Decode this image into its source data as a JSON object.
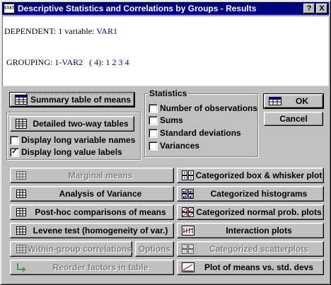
{
  "window": {
    "title": "Descriptive Statistics and Correlations by Groups - Results",
    "help_label": "?",
    "close_label": "X",
    "icon_text": "STAT"
  },
  "results": {
    "dependent_label": "DEPENDENT:",
    "dependent_count": "1 variable:",
    "dependent_var": "VAR1",
    "grouping_label": "GROUPING:",
    "grouping_var": "1-VAR2",
    "grouping_count": "( 4):",
    "grouping_codes": "1 2 3 4"
  },
  "buttons": {
    "summary_table": "Summary table of means",
    "detailed_tables": "Detailed two-way tables",
    "ok": "OK",
    "cancel": "Cancel",
    "marginal_means": "Marginal means",
    "anova": "Analysis of Variance",
    "posthoc": "Post-hoc comparisons of means",
    "levene": "Levene test (homogeneity of var.)",
    "within_group": "Within-group correlations",
    "options": "Options",
    "reorder": "Reorder factors in table",
    "box_whisker": "Categorized box & whisker plot",
    "histograms": "Categorized histograms",
    "normal_prob": "Categorized normal prob. plots",
    "interaction": "Interaction plots",
    "scatterplots": "Categorized scatterplots",
    "means_vs_sd": "Plot of means vs. std. devs"
  },
  "checkboxes": {
    "long_var_names": {
      "label": "Display long variable names",
      "checked": false
    },
    "long_value_labels": {
      "label": "Display long value labels",
      "checked": true
    }
  },
  "statistics": {
    "title": "Statistics",
    "items": [
      {
        "label": "Number of observations",
        "checked": false
      },
      {
        "label": "Sums",
        "checked": false
      },
      {
        "label": "Standard deviations",
        "checked": false
      },
      {
        "label": "Variances",
        "checked": false
      }
    ]
  },
  "colors": {
    "titlebar": "#000080",
    "face": "#c0c0c0",
    "text_blue": "#000080",
    "disabled": "#808080"
  }
}
